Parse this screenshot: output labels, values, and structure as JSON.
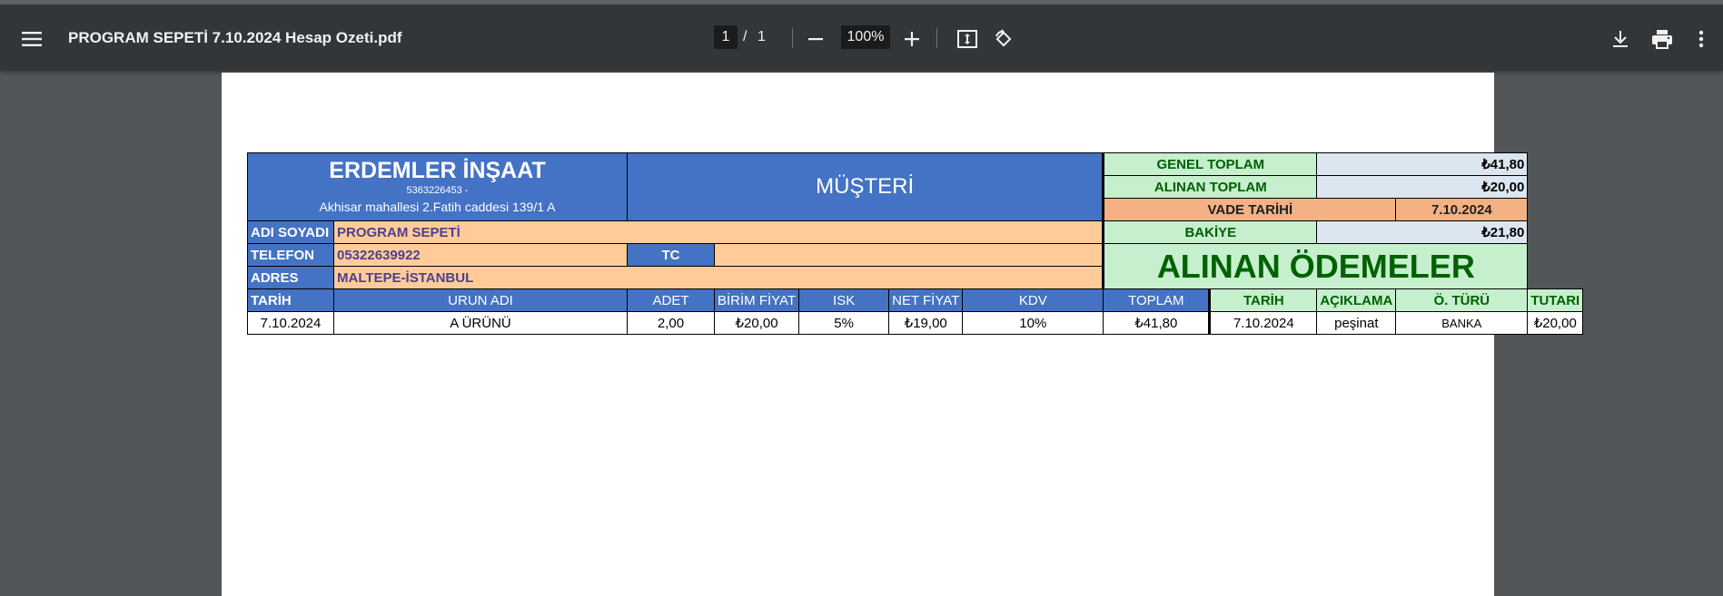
{
  "viewer": {
    "file_name": "PROGRAM SEPETİ 7.10.2024 Hesap Ozeti.pdf",
    "current_page": "1",
    "page_separator": "/",
    "total_pages": "1",
    "zoom": "100%"
  },
  "icons": [
    "menu-icon",
    "zoom-out-icon",
    "zoom-in-icon",
    "fit-page-icon",
    "rotate-icon",
    "download-icon",
    "print-icon",
    "more-icon"
  ],
  "colors": {
    "header_blue": "#4472c4",
    "customer_orange": "#ffcc99",
    "vade_orange": "#f4b183",
    "green_fill": "#c6efce",
    "green_text": "#006100",
    "amount_blue": "#dce6f1"
  },
  "company": {
    "name": "ERDEMLER İNŞAAT",
    "phone": "5363226453 -",
    "address": "Akhisar mahallesi 2.Fatih caddesi 139/1 A"
  },
  "musteri_label": "MÜŞTERİ",
  "summary": {
    "genel_toplam_label": "GENEL TOPLAM",
    "genel_toplam_value": "₺41,80",
    "alinan_toplam_label": "ALINAN TOPLAM",
    "alinan_toplam_value": "₺20,00",
    "vade_tarihi_label": "VADE TARİHİ",
    "vade_tarihi_value": "7.10.2024",
    "bakiye_label": "BAKİYE",
    "bakiye_value": "₺21,80"
  },
  "customer": {
    "name_label": "ADI SOYADI",
    "name_value": "PROGRAM SEPETİ",
    "phone_label": "TELEFON",
    "phone_value": "05322639922",
    "tc_label": "TC",
    "tc_value": "",
    "address_label": "ADRES",
    "address_value": "MALTEPE-İSTANBUL"
  },
  "payments_title": "ALINAN ÖDEMELER",
  "items": {
    "headers": [
      "TARİH",
      "URUN ADI",
      "ADET",
      "BİRİM FİYAT",
      "ISK",
      "NET FİYAT",
      "KDV",
      "TOPLAM"
    ],
    "rows": [
      [
        "7.10.2024",
        "A ÜRÜNÜ",
        "2,00",
        "₺20,00",
        "5%",
        "₺19,00",
        "10%",
        "₺41,80"
      ]
    ]
  },
  "payments": {
    "headers": [
      "TARİH",
      "AÇIKLAMA",
      "Ö. TÜRÜ",
      "TUTARI"
    ],
    "rows": [
      [
        "7.10.2024",
        "peşinat",
        "BANKA",
        "₺20,00"
      ]
    ]
  }
}
